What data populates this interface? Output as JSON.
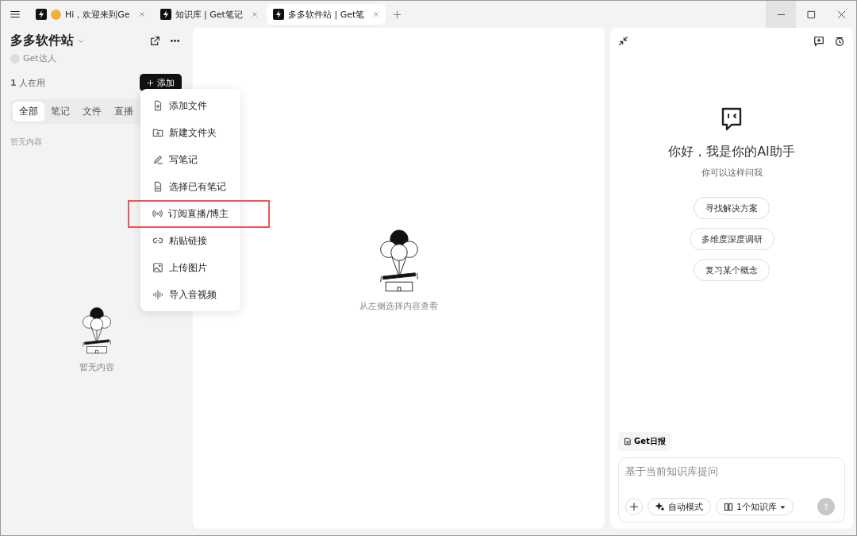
{
  "tabs": [
    {
      "title": "Hi，欢迎来到Ge",
      "hand_emoji": true,
      "selected": false
    },
    {
      "title": "知识库 | Get笔记",
      "hand_emoji": false,
      "selected": false
    },
    {
      "title": "多多软件站 | Get笔",
      "hand_emoji": false,
      "selected": true
    }
  ],
  "sidebar": {
    "title": "多多软件站",
    "role": "Get达人",
    "members": "**1** 人在用",
    "add_button": "添加",
    "filters": [
      {
        "label": "全部",
        "selected": true
      },
      {
        "label": "笔记",
        "selected": false
      },
      {
        "label": "文件",
        "selected": false
      },
      {
        "label": "直播",
        "selected": false
      }
    ],
    "empty_note": "暂无内容",
    "empty_caption": "暂无内容"
  },
  "add_menu": {
    "items": [
      {
        "kind": "file",
        "label": "添加文件",
        "highlighted": false
      },
      {
        "kind": "folder",
        "label": "新建文件夹",
        "highlighted": false
      },
      {
        "kind": "pen",
        "label": "写笔记",
        "highlighted": false
      },
      {
        "kind": "doc",
        "label": "选择已有笔记",
        "highlighted": false
      },
      {
        "kind": "broadcast",
        "label": "订阅直播/博主",
        "highlighted": true
      },
      {
        "kind": "link",
        "label": "粘贴链接",
        "highlighted": false
      },
      {
        "kind": "image",
        "label": "上传图片",
        "highlighted": false
      },
      {
        "kind": "audio",
        "label": "导入音视频",
        "highlighted": false
      }
    ]
  },
  "viewer": {
    "empty_caption": "从左侧选择内容查看"
  },
  "assistant": {
    "greeting": "你好，我是你的AI助手",
    "hint": "你可以这样问我",
    "suggestions": [
      "寻找解决方案",
      "多维度深度调研",
      "复习某个概念"
    ],
    "daily_chip": "Get日报",
    "input": {
      "placeholder": "基于当前知识库提问"
    },
    "mode_button": "自动模式",
    "kb_button": "1个知识库"
  }
}
